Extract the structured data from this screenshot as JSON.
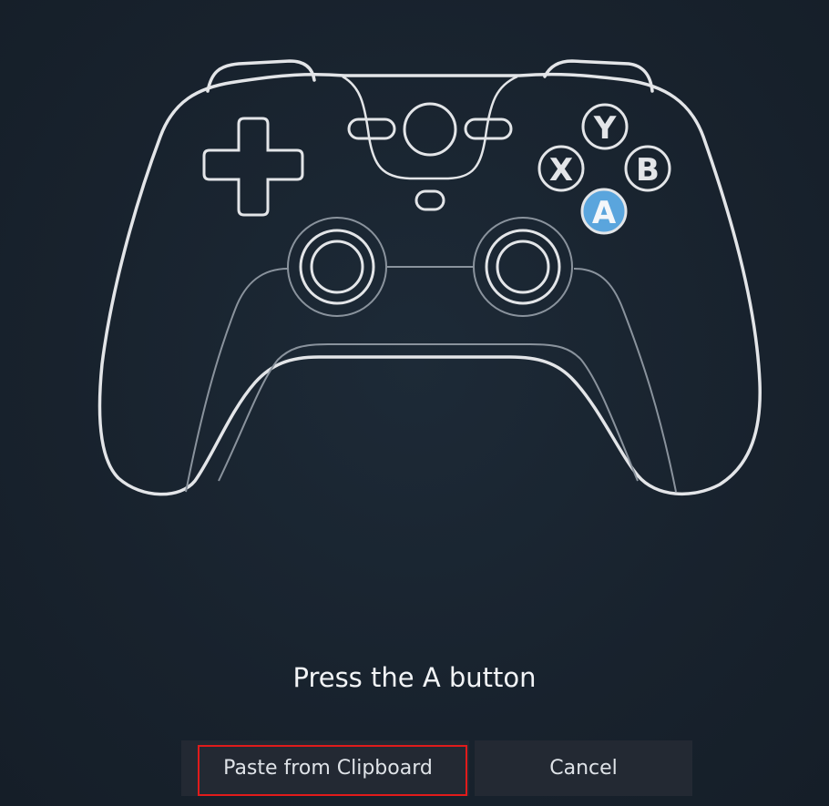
{
  "prompt": {
    "text": "Press the A button"
  },
  "controller": {
    "face_buttons": {
      "y": "Y",
      "x": "X",
      "b": "B",
      "a": "A"
    },
    "highlighted_button": "A",
    "highlight_color": "#5aa5dd",
    "outline_color": "#e3e5e8",
    "inner_line_color": "#8a939d"
  },
  "actions": {
    "paste_label": "Paste from Clipboard",
    "cancel_label": "Cancel"
  },
  "colors": {
    "background": "#1a2430",
    "button_bg": "#232933",
    "focus_ring": "#e11b1b"
  }
}
